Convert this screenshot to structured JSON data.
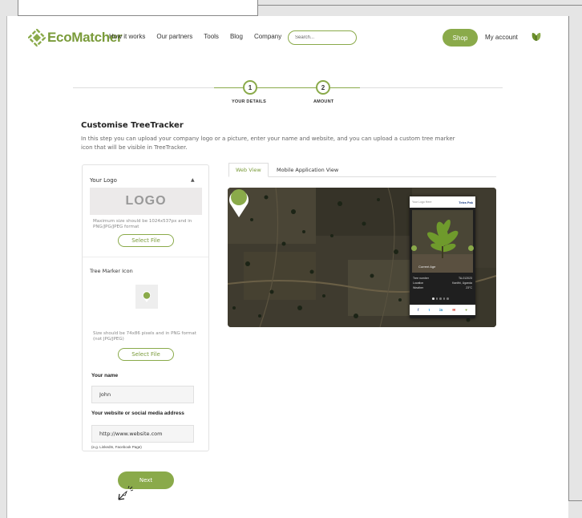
{
  "nav": {
    "brand": "EcoMatcher",
    "links": [
      "How it works",
      "Our partners",
      "Tools",
      "Blog",
      "Company"
    ],
    "search_placeholder": "Search...",
    "shop": "Shop",
    "account": "My account"
  },
  "steps": [
    {
      "number": "1",
      "label": "YOUR DETAILS"
    },
    {
      "number": "2",
      "label": "AMOUNT"
    }
  ],
  "heading": {
    "title": "Customise TreeTracker",
    "description": "In this step you can upload your company logo or a picture, enter your name and website, and you can upload a custom tree marker icon that will be visible in TreeTracker."
  },
  "form": {
    "logo_heading": "Your Logo",
    "logo_placeholder": "LOGO",
    "logo_hint": "Maximum size should be 1024x537px and in PNG/JPG/JPEG format",
    "select_file": "Select File",
    "marker_heading": "Tree Marker Icon",
    "marker_hint": "Size should be 74x86 pixels and in PNG format (not JPG/JPEG)",
    "name_label": "Your name",
    "name_value": "John",
    "website_label": "Your website or social media address",
    "website_value": "http://www.website.com",
    "website_example": "(e.g. LinkedIn, Facebook Page)",
    "next": "Next"
  },
  "tabs": [
    "Web View",
    "Mobile Application View"
  ],
  "preview": {
    "card_header_left": "Your Logo Here",
    "card_header_right": "Tetra Pak",
    "photo_label": "Current Age",
    "rows": [
      {
        "label": "Tree number",
        "value": "TA-012023"
      },
      {
        "label": "Location",
        "value": "Kanithi, Uganda"
      },
      {
        "label": "Weather",
        "value": "23°C"
      }
    ],
    "social": [
      "f",
      "t",
      "in",
      "✉",
      "♥"
    ]
  },
  "colors": {
    "accent": "#8aaa4a",
    "brand_text": "#7a9b3a"
  }
}
